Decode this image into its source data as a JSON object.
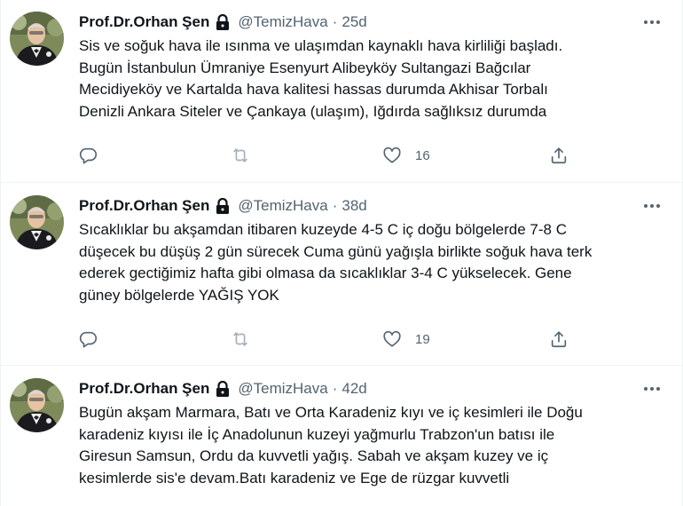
{
  "colors": {
    "text": "#0f1419",
    "muted": "#536471",
    "divider": "#eff3f4"
  },
  "icons": {
    "reply": "reply-icon",
    "retweet": "retweet-icon",
    "like": "heart-icon",
    "share": "share-icon",
    "lock": "lock-icon",
    "more": "more-icon"
  },
  "tweets": [
    {
      "name": "Prof.Dr.Orhan Şen",
      "handle": "@TemizHava",
      "separator": "·",
      "time": "25d",
      "lines": [
        "Sis ve soğuk hava ile ısınma ve ulaşımdan kaynaklı hava kirliliği başladı.",
        "Bugün İstanbulun Ümraniye Esenyurt Alibeyköy Sultangazi Bağcılar",
        "Mecidiyeköy ve Kartalda hava kalitesi hassas durumda Akhisar Torbalı",
        "Denizli Ankara Siteler ve Çankaya (ulaşım),  Iğdırda sağlıksız durumda"
      ],
      "likes": "16"
    },
    {
      "name": "Prof.Dr.Orhan Şen",
      "handle": "@TemizHava",
      "separator": "·",
      "time": "38d",
      "lines": [
        "Sıcaklıklar bu akşamdan itibaren kuzeyde 4-5 C  iç doğu bölgelerde 7-8 C",
        "düşecek bu düşüş 2 gün sürecek Cuma günü yağışla birlikte soğuk hava terk",
        "ederek gectiğimiz hafta gibi olmasa da sıcaklıklar 3-4 C yükselecek. Gene",
        "güney bölgelerde YAĞIŞ YOK"
      ],
      "likes": "19"
    },
    {
      "name": "Prof.Dr.Orhan Şen",
      "handle": "@TemizHava",
      "separator": "·",
      "time": "42d",
      "lines": [
        "Bugün akşam Marmara, Batı ve Orta Karadeniz kıyı ve iç kesimleri ile Doğu",
        "karadeniz kıyısı ile İç Anadolunun kuzeyi yağmurlu Trabzon'un batısı ile",
        "Giresun Samsun, Ordu da kuvvetli yağış. Sabah ve akşam kuzey ve iç",
        "kesimlerde sis'e devam.Batı karadeniz ve Ege de rüzgar kuvvetli"
      ],
      "likes": ""
    }
  ]
}
